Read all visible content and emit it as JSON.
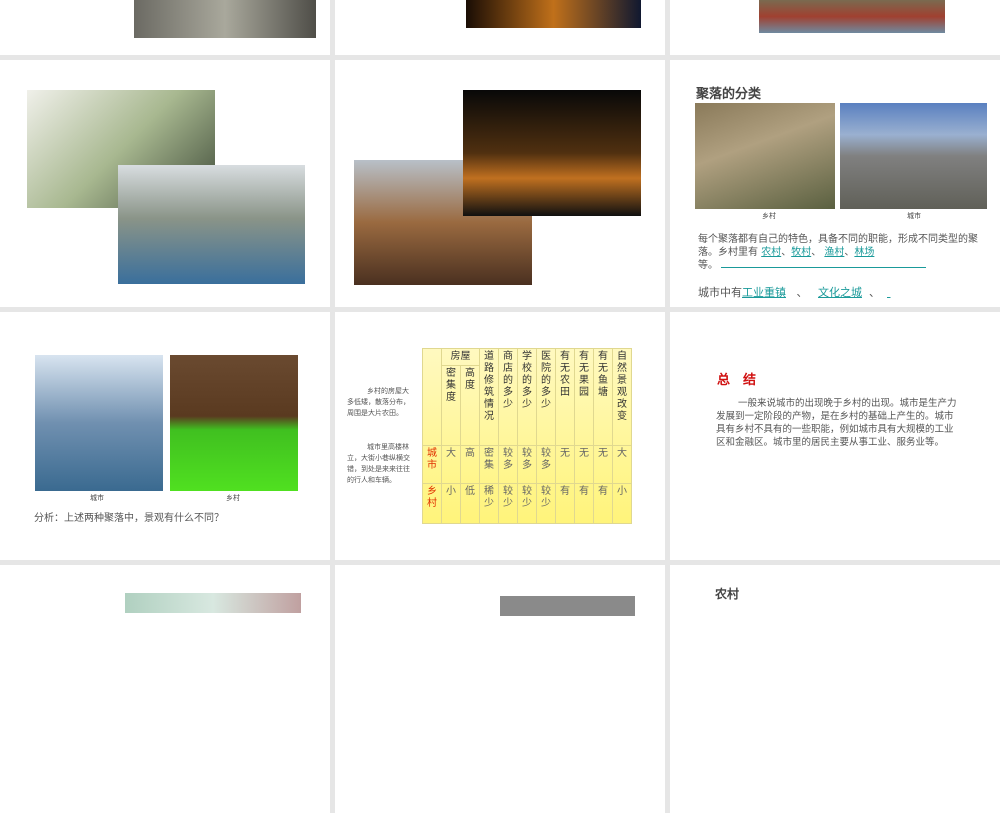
{
  "slide6": {
    "title": "聚落的分类",
    "cap_rural": "乡村",
    "cap_city": "城市",
    "para_text": "每个聚落都有自己的特色，具备不同的职能，形成不同类型的聚落。乡村里有",
    "blank1": "农村",
    "sep1": "、",
    "blank2": "牧村",
    "sep2": "、",
    "blank3": "渔村",
    "sep3": "、",
    "blank4": "林场",
    "etc": "等。",
    "city_prefix": "城市中有",
    "blank5": "工业重镇",
    "sep4": "、",
    "blank6": "文化之城",
    "sep5": "、"
  },
  "slide7": {
    "cap_city": "城市",
    "cap_rural": "乡村",
    "question": "分析：上述两种聚落中，景观有什么不同？"
  },
  "slide8": {
    "note1": "乡村的房屋大多低矮，散落分布，周围是大片农田。",
    "note2": "城市里高楼林立，大街小巷纵横交错，到处是来来往往的行人和车辆。",
    "group_header": "房屋",
    "headers": [
      "密集度",
      "高度",
      "道路修筑情况",
      "商店的多少",
      "学校的多少",
      "医院的多少",
      "有无农田",
      "有无果园",
      "有无鱼塘",
      "自然景观改变"
    ],
    "rows": [
      {
        "label": "城市",
        "values": [
          "大",
          "高",
          "密集",
          "较多",
          "较多",
          "较多",
          "无",
          "无",
          "无",
          "大"
        ]
      },
      {
        "label": "乡村",
        "values": [
          "小",
          "低",
          "稀少",
          "较少",
          "较少",
          "较少",
          "有",
          "有",
          "有",
          "小"
        ]
      }
    ]
  },
  "slide9": {
    "title": "总　结",
    "body": "一般来说城市的出现晚于乡村的出现。城市是生产力发展到一定阶段的产物，是在乡村的基础上产生的。城市具有乡村不具有的一些职能，例如城市具有大规模的工业区和金融区。城市里的居民主要从事工业、服务业等。"
  },
  "slide12": {
    "title": "农村"
  }
}
